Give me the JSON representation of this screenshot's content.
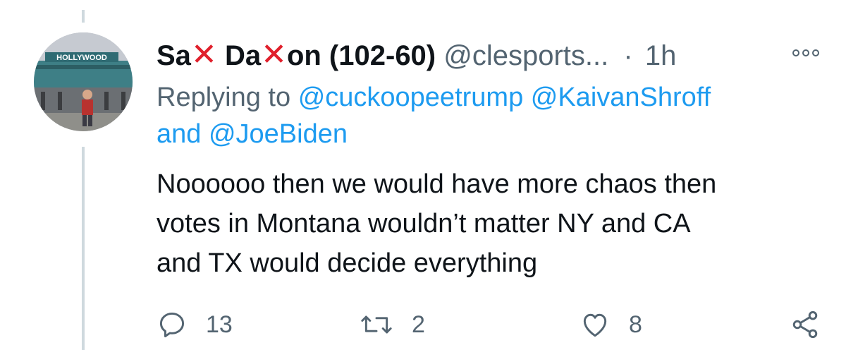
{
  "tweet": {
    "display_name_parts": [
      "Sa",
      "Da",
      "on (102-60)"
    ],
    "display_name_cross": "✕",
    "handle": "@clesports...",
    "separator": "·",
    "time": "1h",
    "replying_label": "Replying to",
    "replying_mentions": [
      "@cuckoopeetrump",
      "@KaivanShroff",
      "@JoeBiden"
    ],
    "replying_and": "and",
    "body_lines": [
      "Noooooo then we would have more chaos then",
      "votes in Montana wouldn’t matter NY and CA",
      "and TX would decide everything"
    ],
    "counts": {
      "reply": "13",
      "retweet": "2",
      "like": "8"
    },
    "avatar_sign_text": "HOLLYWOOD"
  },
  "colors": {
    "link": "#1d9bf0",
    "muted": "#536471",
    "cross": "#e0202c",
    "thread_line": "#cfd9de"
  }
}
